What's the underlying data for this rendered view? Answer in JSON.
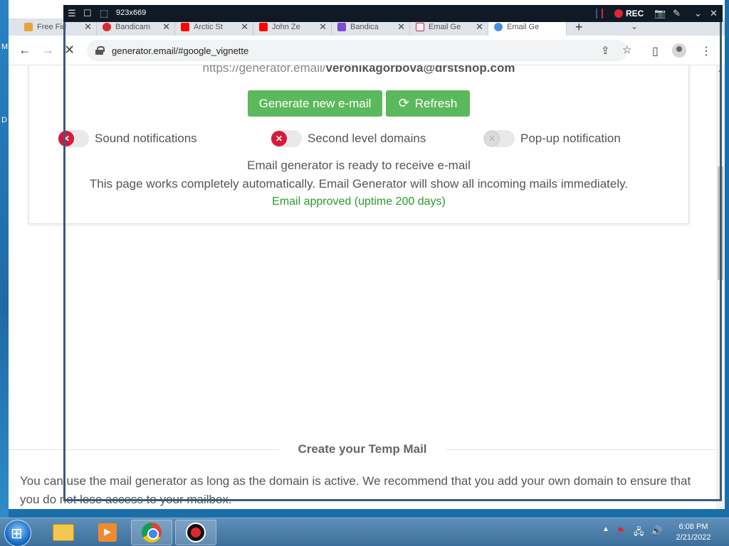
{
  "desktop": {
    "labels": [
      "M",
      "D"
    ]
  },
  "browser": {
    "tabs": [
      {
        "label": "Free Fid",
        "color": "#e8a33a"
      },
      {
        "label": "Bandicam",
        "color": "#e0262f"
      },
      {
        "label": "Arctic St",
        "color": "#ff0000"
      },
      {
        "label": "John Ze",
        "color": "#ff0000"
      },
      {
        "label": "Bandica",
        "color": "#7a4fd0"
      },
      {
        "label": "Email Ge",
        "color": "#d9183b"
      },
      {
        "label": "Email Ge",
        "color": "#4a90d9"
      }
    ],
    "new_tab": "+",
    "tab_menu": "⌄",
    "url": "generator.email/#google_vignette"
  },
  "page": {
    "email_prefix": "https://generator.email/",
    "email_address": "veronikagorbova@drstshop.com",
    "generate_button": "Generate new e-mail",
    "refresh_button": "Refresh",
    "toggles": [
      {
        "label": "Sound notifications",
        "state": "off-red"
      },
      {
        "label": "Second level domains",
        "state": "off-red"
      },
      {
        "label": "Pop-up notification",
        "state": "off-grey"
      }
    ],
    "status_ready": "Email generator is ready to receive e-mail",
    "status_auto": "This page works completely automatically. Email Generator will show all incoming mails immediately.",
    "status_approved": "Email approved (uptime 200 days)",
    "section_title": "Create your Temp Mail",
    "body_text": "You can use the mail generator as long as the domain is active. We recommend that you add your own domain to ensure that you do not lose access to your mailbox."
  },
  "recorder": {
    "dims": "923x669",
    "rec_label": "REC"
  },
  "taskbar": {
    "time": "6:08 PM",
    "date": "2/21/2022"
  },
  "colors": {
    "accent_green": "#5cb85c",
    "approved_green": "#2a9a2a",
    "toggle_red": "#d9183b",
    "rec_red": "#e0262f"
  }
}
